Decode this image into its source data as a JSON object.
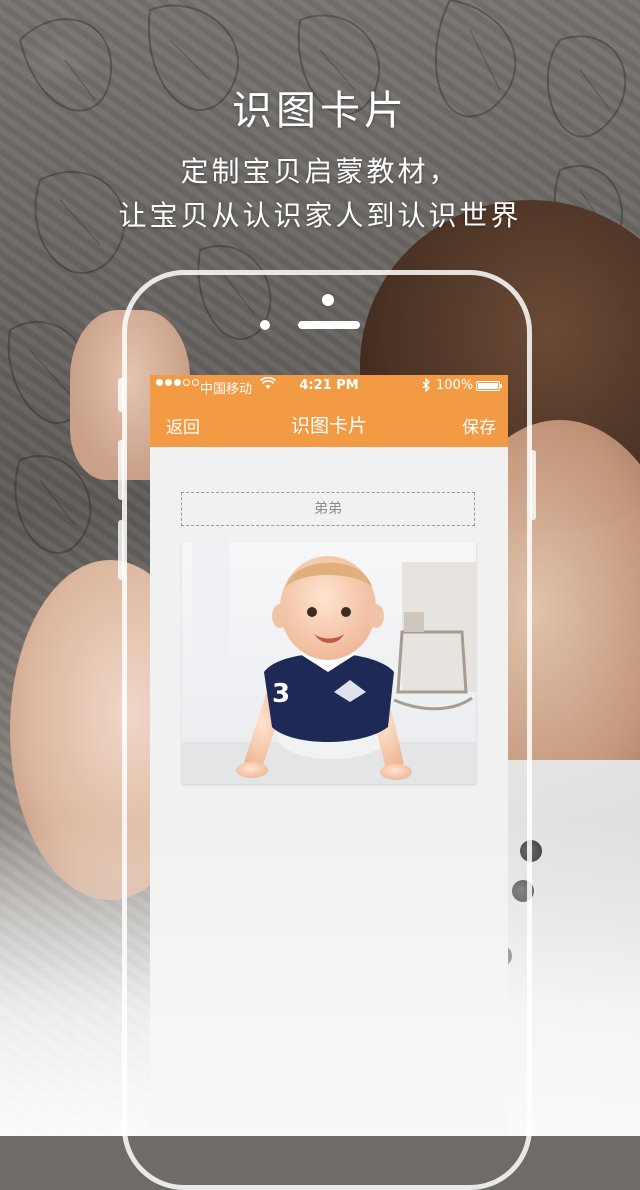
{
  "headline": {
    "title": "识图卡片",
    "line1": "定制宝贝启蒙教材，",
    "line2": "让宝贝从认识家人到认识世界"
  },
  "status_bar": {
    "carrier": "中国移动",
    "time": "4:21 PM",
    "battery": "100%",
    "signal_bars_filled": 3,
    "signal_bars_total": 5
  },
  "nav": {
    "back_label": "返回",
    "title": "识图卡片",
    "save_label": "保存"
  },
  "card": {
    "name_value": "弟弟",
    "photo_jersey_number": "3"
  },
  "colors": {
    "accent": "#f39a44",
    "screen_bg": "#f1f1f1"
  }
}
